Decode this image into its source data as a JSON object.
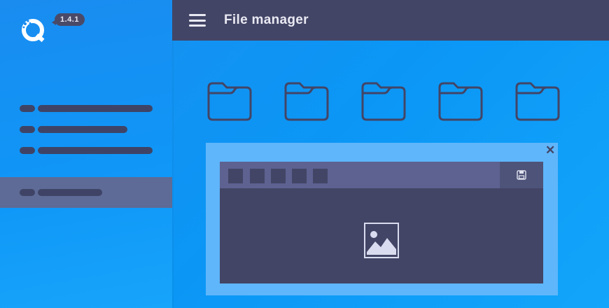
{
  "app": {
    "version": "1.4.1",
    "title": "File manager"
  },
  "sidebar": {
    "items": [
      {
        "id": "item-1",
        "active": false
      },
      {
        "id": "item-2",
        "active": false
      },
      {
        "id": "item-3",
        "active": false
      },
      {
        "id": "item-4",
        "active": true
      }
    ]
  },
  "folders": [
    "folder-icon",
    "folder-icon",
    "folder-icon",
    "folder-icon",
    "folder-icon"
  ],
  "preview": {
    "toolbar_buttons": 5,
    "save_icon": "save-icon",
    "close_icon": "close-icon",
    "content_icon": "image-icon"
  },
  "colors": {
    "accent": "#0f96f7",
    "header": "#434566",
    "active_item": "#5e6b96",
    "toolbar": "#5d6291"
  }
}
